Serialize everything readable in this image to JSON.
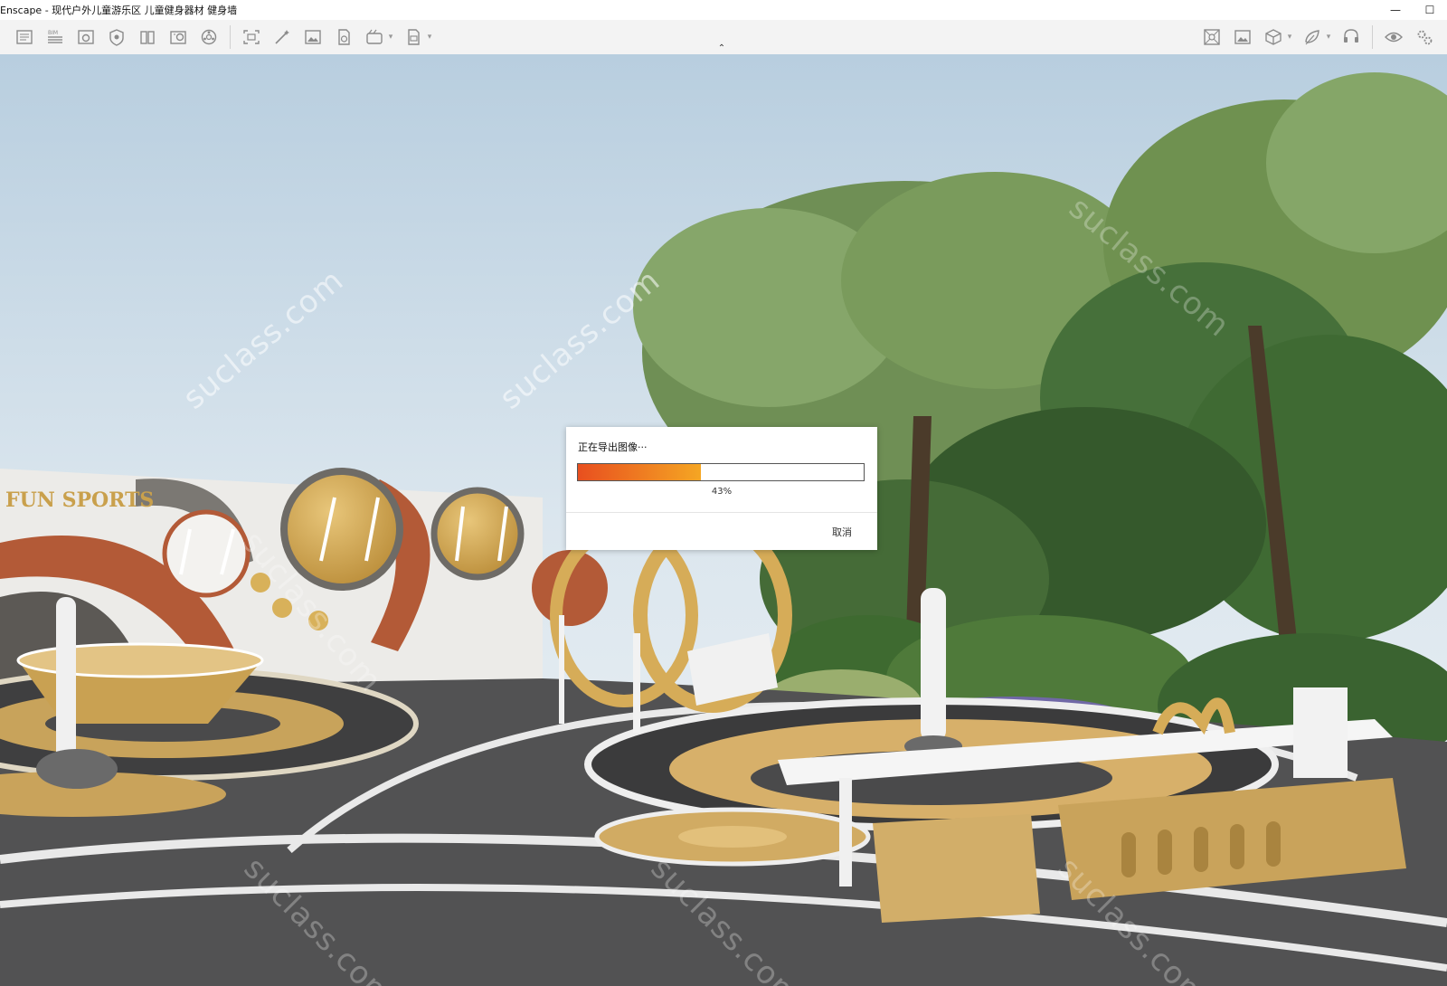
{
  "window": {
    "title": "Enscape - 现代户外儿童游乐区 儿童健身器材 健身墙",
    "minimize_glyph": "—",
    "maximize_glyph": "☐",
    "close_glyph": "✕"
  },
  "toolbar": {
    "left_icons": [
      "project-info-icon",
      "bim-icon",
      "views-icon",
      "asset-library-icon",
      "materials-icon",
      "material-editor-icon",
      "atmosphere-icon",
      "screenshot-icon",
      "batch-render-icon",
      "image-export-icon",
      "panorama-icon",
      "video-editor-icon",
      "web-export-icon"
    ],
    "right_icons": [
      "orthographic-icon",
      "image-overlay-icon",
      "section-cube-icon",
      "feedback-icon",
      "headset-icon",
      "eye-visibility-icon",
      "settings-icon"
    ],
    "collapse_glyph": "⌃"
  },
  "viewport": {
    "watermark_text": "suclass.com",
    "sign_text": "FUN SPORTS"
  },
  "dialog": {
    "message": "正在导出图像···",
    "progress": 0.43,
    "progress_label": "43%",
    "cancel_label": "取消",
    "colors": {
      "progress_start": "#e84f1f",
      "progress_end": "#f5a623"
    }
  }
}
